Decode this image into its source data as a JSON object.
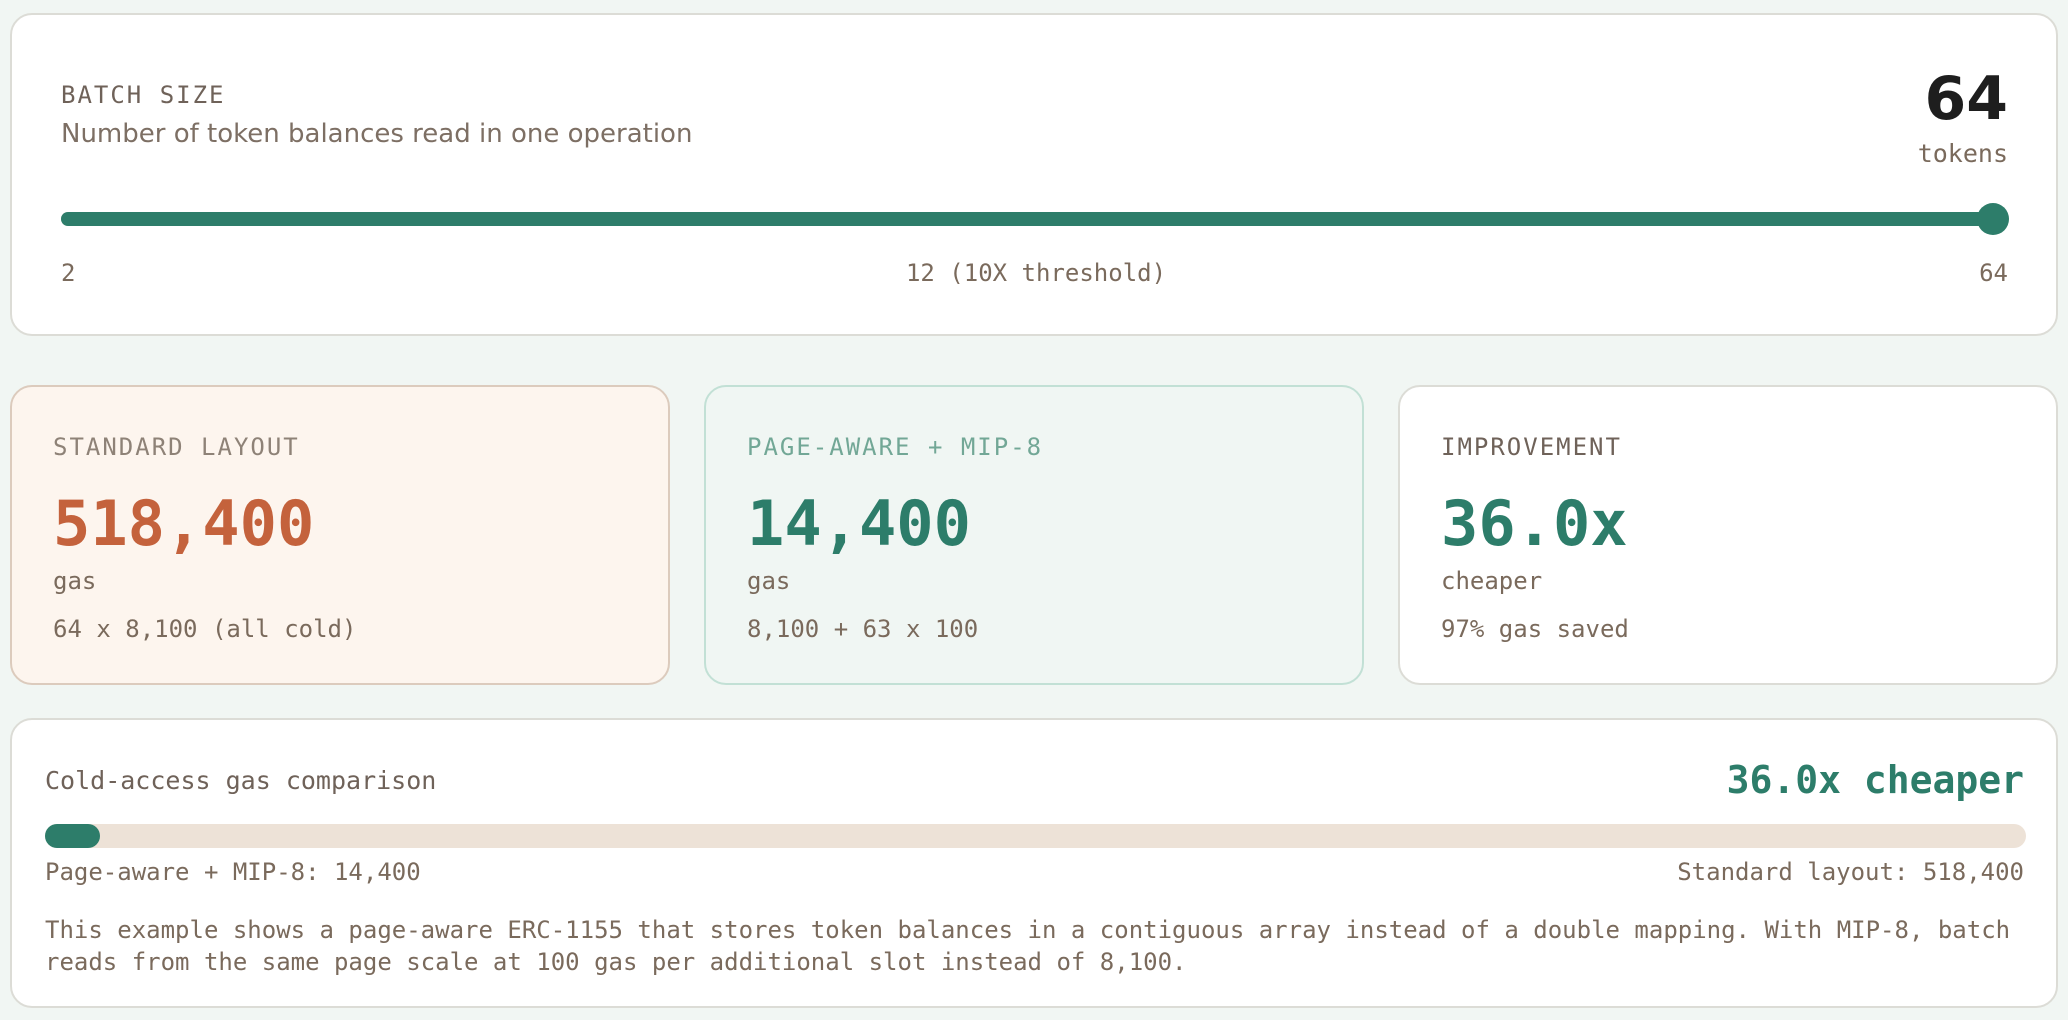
{
  "slider": {
    "label": "BATCH SIZE",
    "description": "Number of token balances read in one operation",
    "value": "64",
    "value_unit": "tokens",
    "min": 2,
    "max": 64,
    "current": 64,
    "min_label": "2",
    "mid_label": "12 (10X threshold)",
    "max_label": "64"
  },
  "cards": {
    "standard": {
      "label": "STANDARD LAYOUT",
      "value": "518,400",
      "unit": "gas",
      "detail": "64 x 8,100 (all cold)"
    },
    "pageaware": {
      "label": "PAGE-AWARE + MIP-8",
      "value": "14,400",
      "unit": "gas",
      "detail": "8,100 + 63 x 100"
    },
    "improvement": {
      "label": "IMPROVEMENT",
      "value": "36.0x",
      "unit": "cheaper",
      "detail": "97% gas saved"
    }
  },
  "comparison": {
    "title": "Cold-access gas comparison",
    "badge": "36.0x cheaper",
    "fraction": 0.0278,
    "left_label": "Page-aware + MIP-8: 14,400",
    "right_label": "Standard layout: 518,400",
    "note": "This example shows a page-aware ERC-1155 that stores token balances in a contiguous array instead of a double mapping. With MIP-8, batch reads from the same page scale at 100 gas per additional slot instead of 8,100."
  },
  "colors": {
    "accent": "#2d7d6a",
    "standard_accent": "#c4623c",
    "track": "#ede2d7"
  }
}
